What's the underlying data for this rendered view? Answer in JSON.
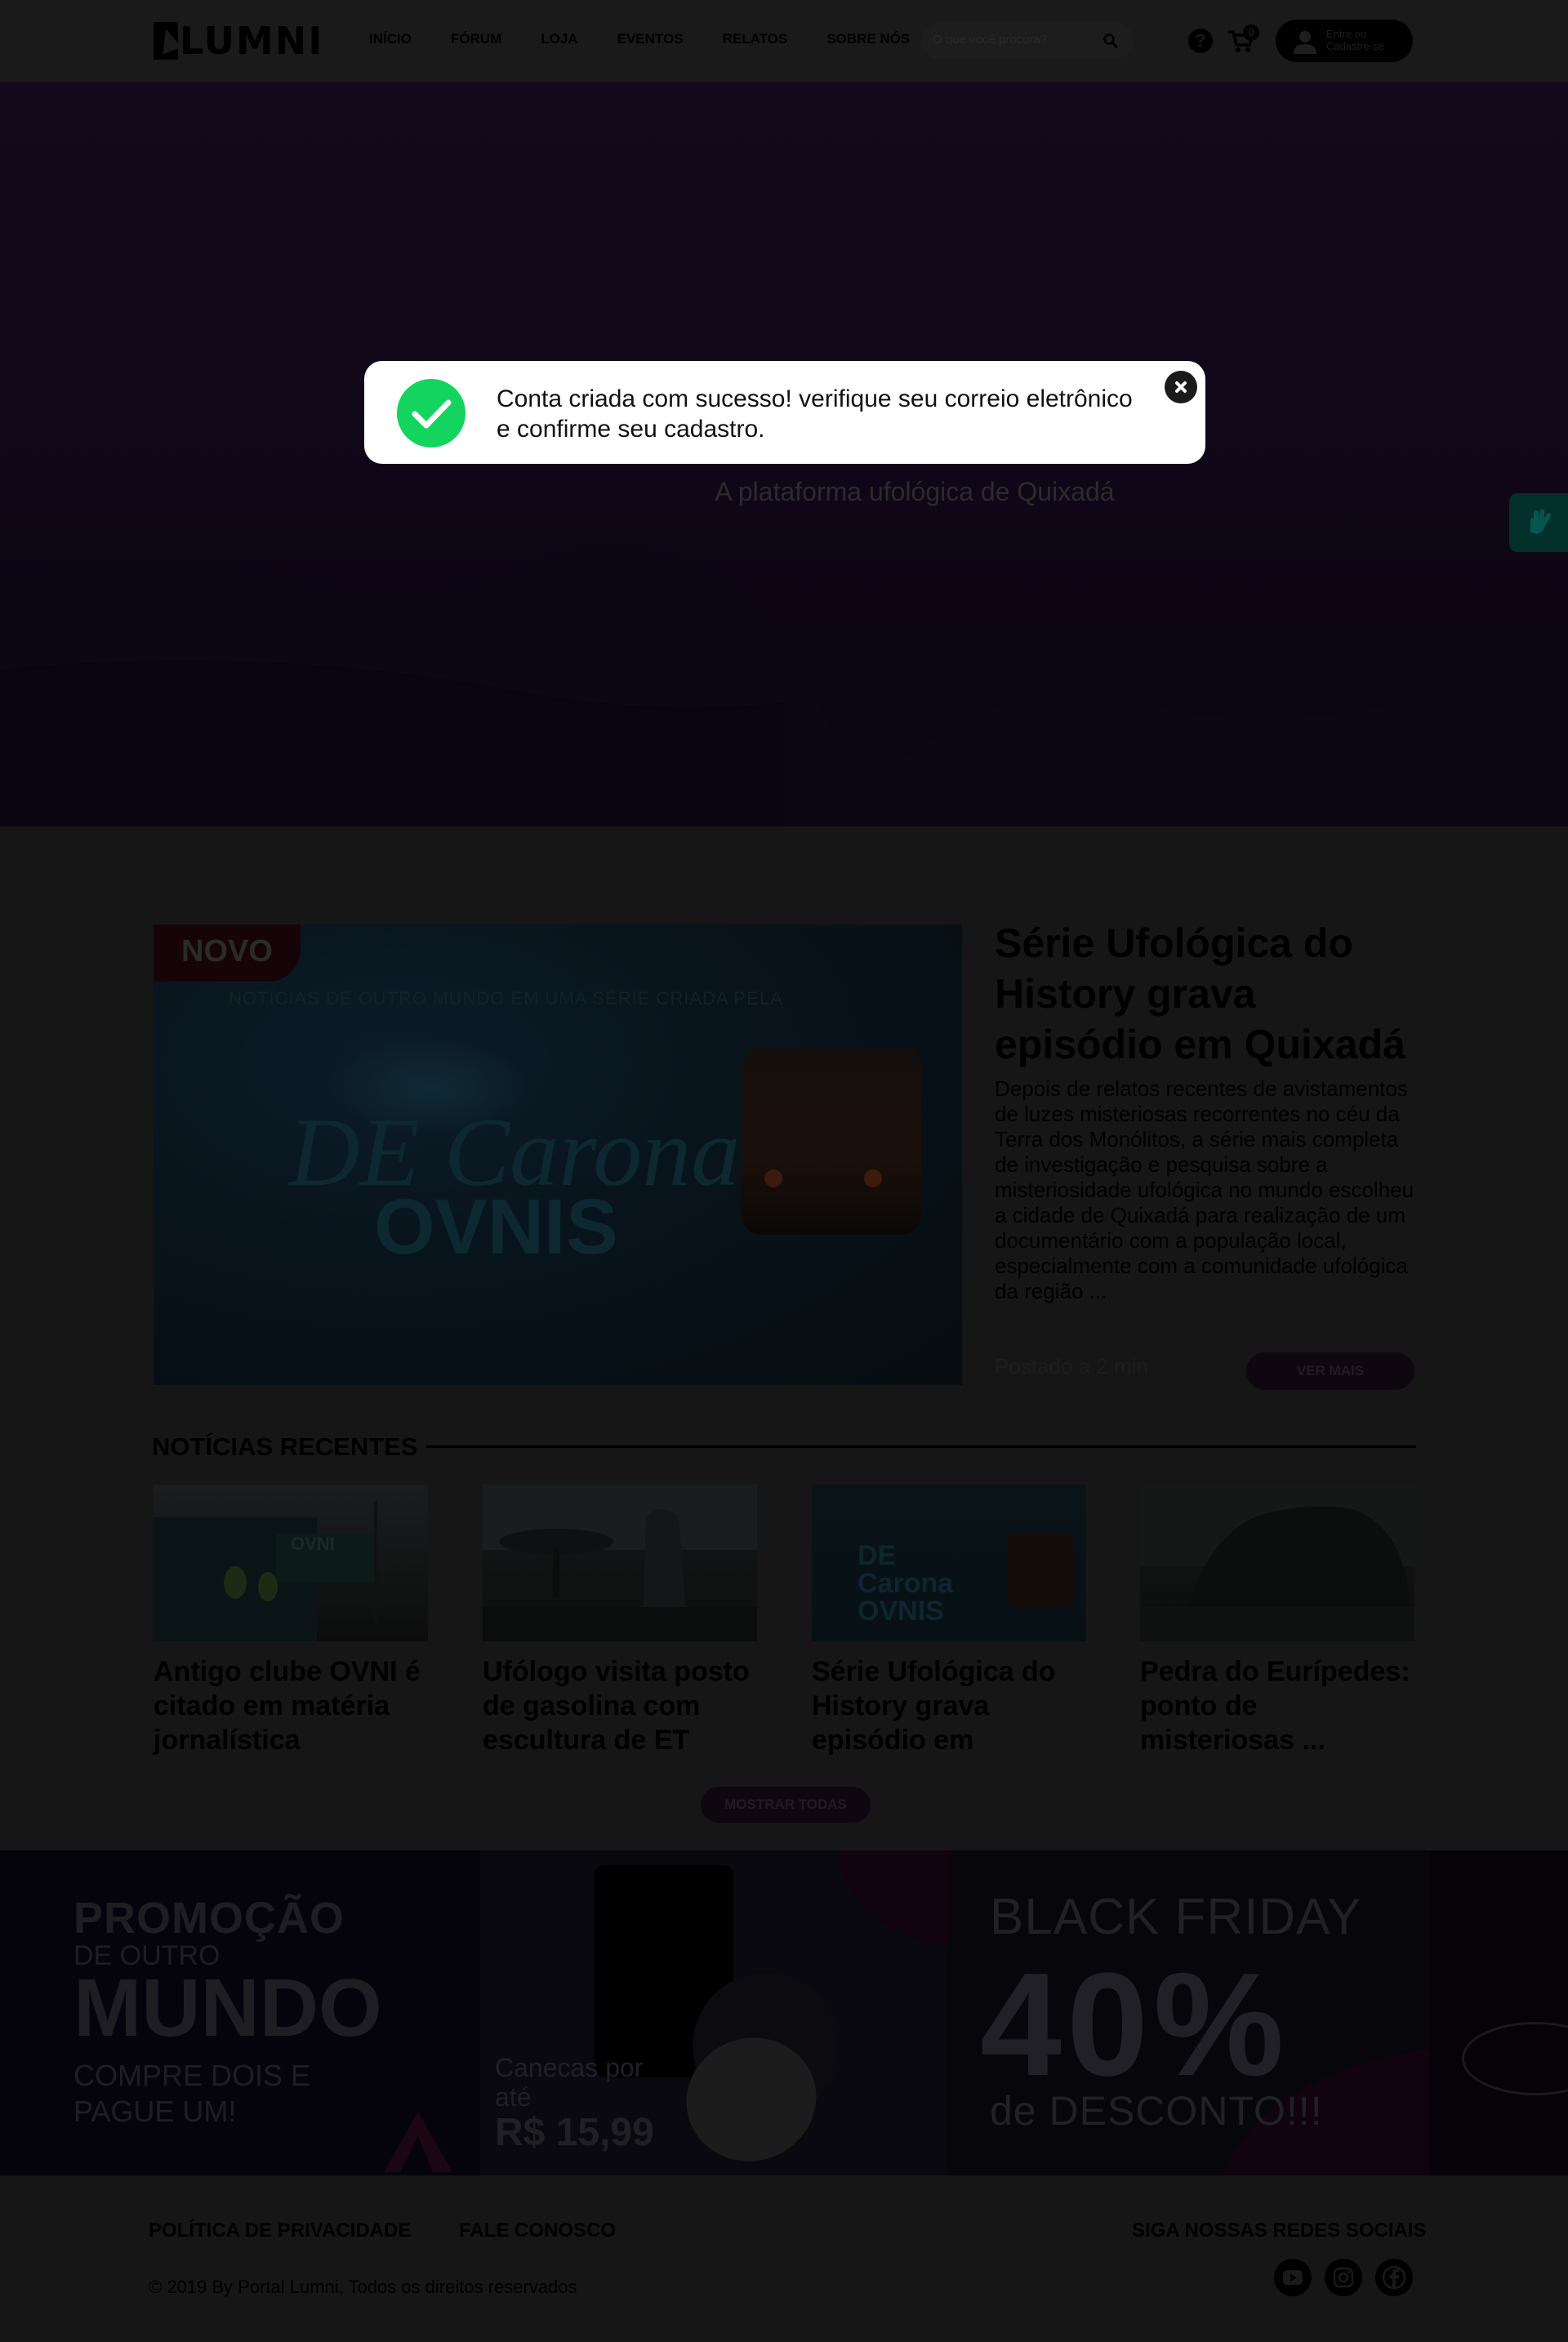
{
  "header": {
    "logo_text": "LUMNI",
    "nav": [
      "INÍCIO",
      "FÓRUM",
      "LOJA",
      "EVENTOS",
      "RELATOS",
      "SOBRE NÓS"
    ],
    "search_placeholder": "O que você procura?",
    "help_glyph": "?",
    "cart_count": "0",
    "login_label": "Entre ou Cadastre-se",
    "icons": [
      "search-icon",
      "help-icon",
      "cart-icon",
      "user-icon"
    ]
  },
  "hero": {
    "subtitle": "A plataforma ufológica de Quixadá",
    "accessibility_widget": "vlibras-hand-icon"
  },
  "toast": {
    "message": "Conta criada com sucesso! verifique seu correio eletrônico e confirme seu cadastro.",
    "icons": [
      "check-icon",
      "close-icon"
    ],
    "check_color": "#13d45e"
  },
  "featured": {
    "tag": "NOVO",
    "image_caption": "NOTÍCIAS DE OUTRO MUNDO EM UMA SÉRIE CRIADA PELA",
    "image_logo_1": "DE Carona",
    "image_logo_2": "OVNIS",
    "title": "Série Ufológica do History grava episódio em Quixadá",
    "body": "Depois de relatos recentes de avistamentos de luzes misteriosas recorrentes no céu da Terra dos Monólitos, a série mais completa de investigação e pesquisa sobre a misteriosidade ufológica no mundo escolheu a cidade de Quixadá para realização de um documentário com a população local, especialmente com a comunidade ufológica da região ...",
    "posted": "Postado a 2 min",
    "button": "VER MAIS"
  },
  "recent": {
    "heading": "NOTÍCIAS RECENTES",
    "items": [
      {
        "title": "Antigo clube OVNI é citado em matéria jornalística",
        "image_text": "OVNI"
      },
      {
        "title": "Ufólogo visita posto de gasolina com escultura de ET"
      },
      {
        "title": "Série Ufológica do History grava episódio em",
        "image_text": "DE Carona OVNIS"
      },
      {
        "title": "Pedra do Eurípedes: ponto de misteriosas ..."
      }
    ],
    "button": "MOSTRAR TODAS"
  },
  "promo": {
    "a": {
      "line1": "PROMOÇÃO",
      "line2": "DE OUTRO",
      "line3": "MUNDO",
      "line4": "COMPRE DOIS E PAGUE UM!"
    },
    "b": {
      "line1": "Canecas por até",
      "price": "R$ 15,99"
    },
    "c": {
      "line1": "BLACK FRIDAY",
      "line2": "40%",
      "line3": "de DESCONTO!!!"
    }
  },
  "footer": {
    "links": [
      "POLÍTICA DE PRIVACIDADE",
      "FALE CONOSCO"
    ],
    "copyright": "© 2019 By Portal Lumni, Todos os direitos reservados",
    "social_heading": "SIGA NOSSAS REDES SOCIAIS",
    "social_icons": [
      "youtube-icon",
      "instagram-icon",
      "facebook-icon"
    ]
  }
}
